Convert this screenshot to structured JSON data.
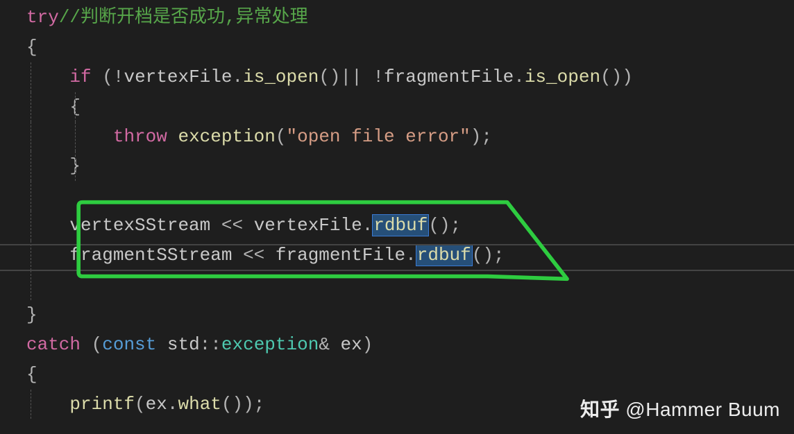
{
  "code": {
    "l1": {
      "kw_try": "try",
      "comment": "//判断开档是否成功,异常处理"
    },
    "l2": {
      "brace": "{"
    },
    "l3": {
      "kw_if": "if",
      "open_paren": " (",
      "bang1": "!",
      "var1": "vertexFile",
      "dot1": ".",
      "method1": "is_open",
      "call1": "()",
      "orop": "||",
      "space_or": " ",
      "bang2": "!",
      "var2": "fragmentFile",
      "dot2": ".",
      "method2": "is_open",
      "call2": "()",
      "close_paren": ")"
    },
    "l4": {
      "brace": "{"
    },
    "l5": {
      "kw_throw": "throw",
      "space": " ",
      "exception": "exception",
      "open": "(",
      "str": "\"open file error\"",
      "close": ")",
      "semi": ";"
    },
    "l6": {
      "brace": "}"
    },
    "l7": {
      "blank": ""
    },
    "l8": {
      "var": "vertexSStream",
      "op": " << ",
      "file": "vertexFile",
      "dot": ".",
      "method": "rdbuf",
      "call": "()",
      "semi": ";"
    },
    "l9": {
      "var": "fragmentSStream",
      "op": " << ",
      "file": "fragmentFile",
      "dot": ".",
      "method": "rdbuf",
      "call": "()",
      "semi": ";"
    },
    "l10": {
      "blank": ""
    },
    "l11": {
      "brace": "}"
    },
    "l12": {
      "kw_catch": "catch",
      "open": " (",
      "kw_const": "const",
      "space": " ",
      "ns": "std",
      "scope": "::",
      "type": "exception",
      "amp": "& ",
      "var": "ex",
      "close": ")"
    },
    "l13": {
      "brace": "{"
    },
    "l14": {
      "fn": "printf",
      "open": "(",
      "var": "ex",
      "dot": ".",
      "method": "what",
      "call": "()",
      "close": ")",
      "semi": ";"
    }
  },
  "watermark": {
    "zh": "知乎",
    "at": " @",
    "name": "Hammer Buum"
  },
  "annotation_color": "#2ecc40"
}
